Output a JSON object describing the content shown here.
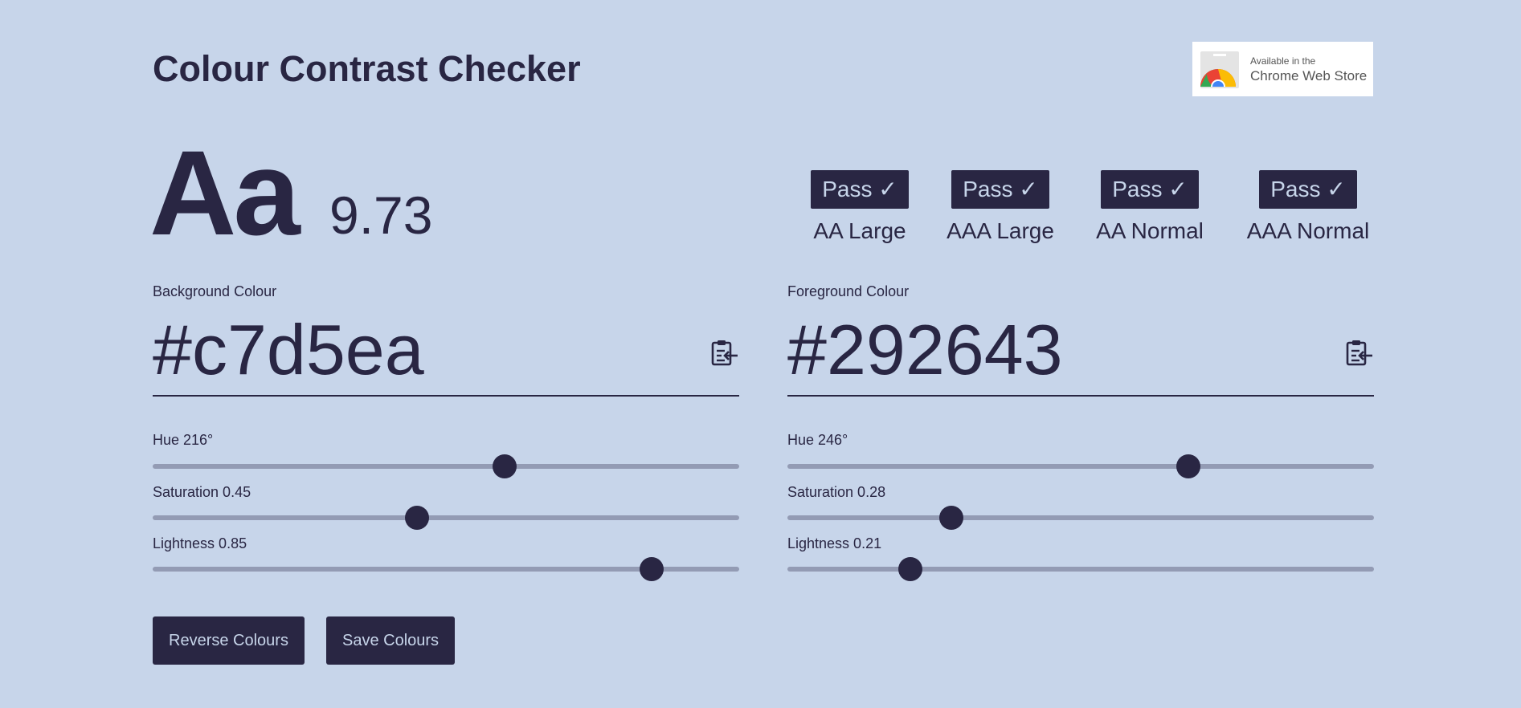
{
  "app": {
    "title": "Colour Contrast Checker"
  },
  "store_badge": {
    "small_text": "Available in the",
    "big_text": "Chrome Web Store",
    "icon": "chrome-logo-icon"
  },
  "preview": {
    "sample_text": "Aa",
    "ratio": "9.73"
  },
  "results": [
    {
      "status": "Pass ✓",
      "label": "AA Large"
    },
    {
      "status": "Pass ✓",
      "label": "AAA Large"
    },
    {
      "status": "Pass ✓",
      "label": "AA Normal"
    },
    {
      "status": "Pass ✓",
      "label": "AAA Normal"
    }
  ],
  "background": {
    "label": "Background Colour",
    "hex": "#c7d5ea",
    "paste_icon": "clipboard-paste-icon",
    "hue": {
      "label": "Hue 216°",
      "value": 216,
      "max": 360
    },
    "saturation": {
      "label": "Saturation 0.45",
      "value": 0.45,
      "max": 1
    },
    "lightness": {
      "label": "Lightness 0.85",
      "value": 0.85,
      "max": 1
    }
  },
  "foreground": {
    "label": "Foreground Colour",
    "hex": "#292643",
    "paste_icon": "clipboard-paste-icon",
    "hue": {
      "label": "Hue 246°",
      "value": 246,
      "max": 360
    },
    "saturation": {
      "label": "Saturation 0.28",
      "value": 0.28,
      "max": 1
    },
    "lightness": {
      "label": "Lightness 0.21",
      "value": 0.21,
      "max": 1
    }
  },
  "actions": {
    "reverse_label": "Reverse Colours",
    "save_label": "Save Colours"
  },
  "colors": {
    "background": "#c7d5ea",
    "foreground": "#292643",
    "track": "#939bb4"
  }
}
